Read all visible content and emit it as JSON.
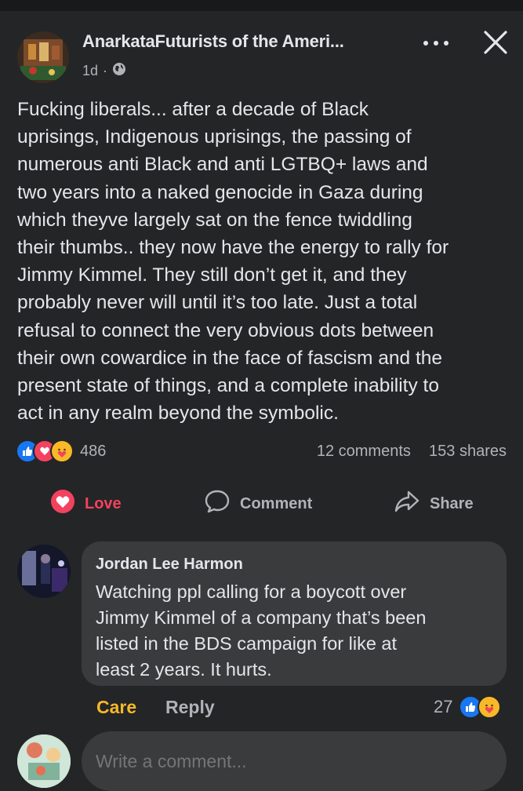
{
  "post": {
    "page_name": "AnarkataFuturists of the Ameri...",
    "time": "1d",
    "separator": "·",
    "audience_icon": "globe-icon",
    "more_icon": "more-dots-icon",
    "close_icon": "close-icon",
    "body_lines": [
      "Fucking liberals... after a decade of Black",
      "uprisings, Indigenous uprisings, the passing of",
      "numerous anti Black and anti LGTBQ+ laws and",
      "two years into a naked genocide in Gaza during",
      "which theyve largely sat on the fence twiddling",
      "their thumbs.. they now have the energy to rally for",
      "Jimmy Kimmel. They still don’t get it, and they",
      "probably never will until it’s too late. Just a total",
      "refusal to connect the very obvious dots between",
      "their own cowardice in the face of fascism and the",
      "present state of things, and a complete inability to",
      "act in any realm beyond the symbolic."
    ]
  },
  "stats": {
    "reaction_icons": [
      "like-icon",
      "love-icon",
      "care-icon"
    ],
    "reaction_count": "486",
    "comments": "12 comments",
    "shares": "153 shares"
  },
  "actions": {
    "love_label": "Love",
    "comment_label": "Comment",
    "share_label": "Share"
  },
  "comment": {
    "author": "Jordan Lee Harmon",
    "text_lines": [
      "Watching ppl calling for a boycott over",
      "Jimmy Kimmel of a company that’s been",
      "listed in the BDS campaign for like at",
      "least 2 years. It hurts."
    ],
    "care_label": "Care",
    "reply_label": "Reply",
    "reaction_count": "27",
    "reaction_icons": [
      "like-icon",
      "care-icon"
    ]
  },
  "composer": {
    "placeholder": "Write a comment..."
  },
  "colors": {
    "background": "#242526",
    "bubble": "#3a3b3c",
    "text_primary": "#e4e6eb",
    "text_secondary": "#b0b3b8",
    "love": "#f3425f",
    "care": "#f7b928",
    "like": "#1877f2"
  }
}
